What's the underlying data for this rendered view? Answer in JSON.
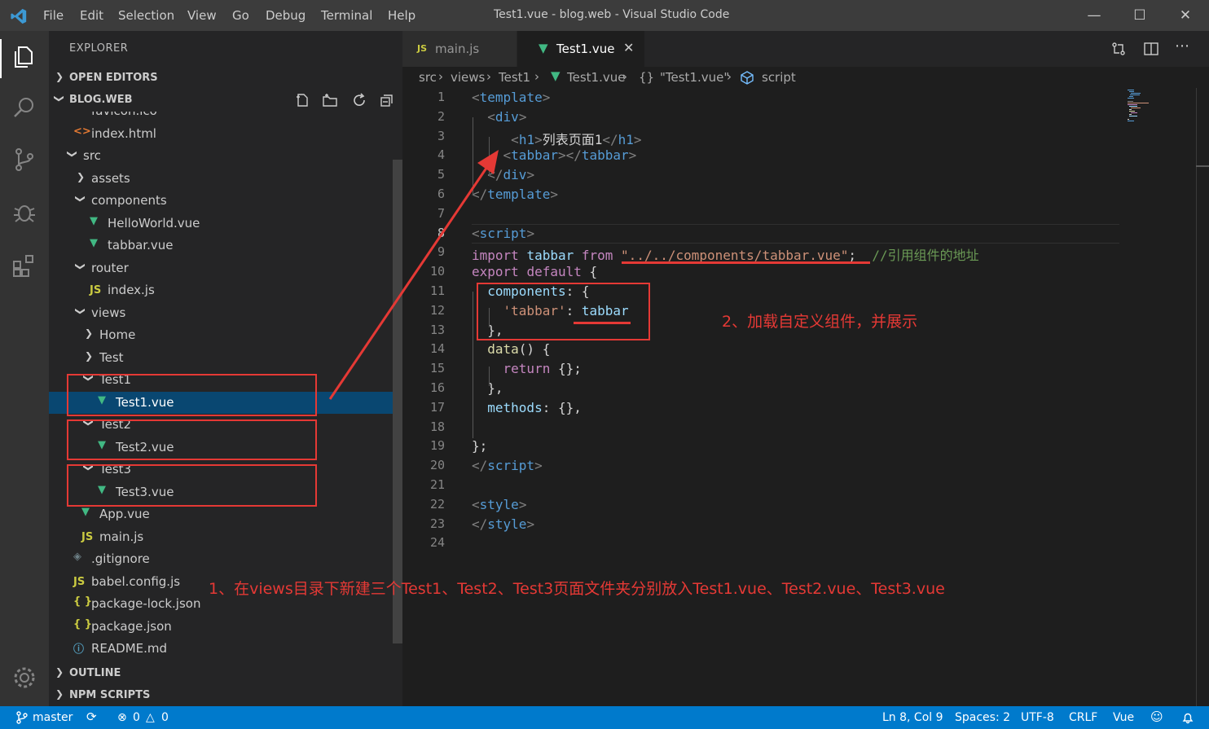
{
  "titlebar": {
    "menu": [
      "File",
      "Edit",
      "Selection",
      "View",
      "Go",
      "Debug",
      "Terminal",
      "Help"
    ],
    "title": "Test1.vue - blog.web - Visual Studio Code",
    "vscode_color": "#3c99d4"
  },
  "activity": [
    "files-icon",
    "search-icon",
    "source-control-icon",
    "debug-icon",
    "extensions-icon",
    "settings-gear-icon"
  ],
  "sidebar": {
    "header": "EXPLORER",
    "open_editors": "OPEN EDITORS",
    "folder": "BLOG.WEB",
    "outline": "OUTLINE",
    "npm": "NPM SCRIPTS",
    "tree": [
      {
        "label": "favicon.ico",
        "icon": "star"
      },
      {
        "label": "index.html",
        "icon": "html"
      },
      {
        "label": "src",
        "icon": "folder-open"
      },
      {
        "label": "assets",
        "icon": "folder-closed"
      },
      {
        "label": "components",
        "icon": "folder-open"
      },
      {
        "label": "HelloWorld.vue",
        "icon": "vue"
      },
      {
        "label": "tabbar.vue",
        "icon": "vue"
      },
      {
        "label": "router",
        "icon": "folder-open"
      },
      {
        "label": "index.js",
        "icon": "js"
      },
      {
        "label": "views",
        "icon": "folder-open"
      },
      {
        "label": "Home",
        "icon": "folder-closed"
      },
      {
        "label": "Test",
        "icon": "folder-closed"
      },
      {
        "label": "Test1",
        "icon": "folder-open"
      },
      {
        "label": "Test1.vue",
        "icon": "vue"
      },
      {
        "label": "Test2",
        "icon": "folder-open"
      },
      {
        "label": "Test2.vue",
        "icon": "vue"
      },
      {
        "label": "Test3",
        "icon": "folder-open"
      },
      {
        "label": "Test3.vue",
        "icon": "vue"
      },
      {
        "label": "App.vue",
        "icon": "vue"
      },
      {
        "label": "main.js",
        "icon": "js"
      },
      {
        "label": ".gitignore",
        "icon": "git"
      },
      {
        "label": "babel.config.js",
        "icon": "js"
      },
      {
        "label": "package-lock.json",
        "icon": "json"
      },
      {
        "label": "package.json",
        "icon": "json"
      },
      {
        "label": "README.md",
        "icon": "info"
      }
    ]
  },
  "tabs": [
    {
      "label": "main.js",
      "badge": "JS",
      "active": false
    },
    {
      "label": "Test1.vue",
      "active": true
    }
  ],
  "breadcrumb": [
    "src",
    "views",
    "Test1",
    "Test1.vue",
    "{}",
    "\"Test1.vue\"",
    "script"
  ],
  "editor": {
    "line_numbers": [
      "1",
      "2",
      "3",
      "4",
      "5",
      "6",
      "7",
      "8",
      "9",
      "10",
      "11",
      "12",
      "13",
      "14",
      "15",
      "16",
      "17",
      "18",
      "19",
      "20",
      "21",
      "22",
      "23",
      "24"
    ],
    "lines": [
      [
        [
          "k-br",
          "<"
        ],
        [
          "k-tag",
          "template"
        ],
        [
          "k-br",
          ">"
        ]
      ],
      [
        [
          "k-punc",
          "  "
        ],
        [
          "k-br",
          "<"
        ],
        [
          "k-tag",
          "div"
        ],
        [
          "k-br",
          ">"
        ]
      ],
      [
        [
          "k-punc",
          "     "
        ],
        [
          "k-br",
          "<"
        ],
        [
          "k-tag",
          "h1"
        ],
        [
          "k-br",
          ">"
        ],
        [
          "k-punc",
          "列表页面1"
        ],
        [
          "k-br",
          "</"
        ],
        [
          "k-tag",
          "h1"
        ],
        [
          "k-br",
          ">"
        ]
      ],
      [
        [
          "k-punc",
          "    "
        ],
        [
          "k-br",
          "<"
        ],
        [
          "k-tag",
          "tabbar"
        ],
        [
          "k-br",
          "></"
        ],
        [
          "k-tag",
          "tabbar"
        ],
        [
          "k-br",
          ">"
        ]
      ],
      [
        [
          "k-punc",
          "  "
        ],
        [
          "k-br",
          "</"
        ],
        [
          "k-tag",
          "div"
        ],
        [
          "k-br",
          ">"
        ]
      ],
      [
        [
          "k-br",
          "</"
        ],
        [
          "k-tag",
          "template"
        ],
        [
          "k-br",
          ">"
        ]
      ],
      [],
      [
        [
          "k-br",
          "<"
        ],
        [
          "k-tag",
          "script"
        ],
        [
          "k-br",
          ">"
        ]
      ],
      [
        [
          "k-kw",
          "import"
        ],
        [
          "k-punc",
          " "
        ],
        [
          "k-var",
          "tabbar"
        ],
        [
          "k-punc",
          " "
        ],
        [
          "k-kw",
          "from"
        ],
        [
          "k-punc",
          " "
        ],
        [
          "k-str",
          "\"../../components/tabbar.vue\""
        ],
        [
          "k-punc",
          ";  "
        ],
        [
          "k-cm",
          "//引用组件的地址"
        ]
      ],
      [
        [
          "k-kw",
          "export"
        ],
        [
          "k-punc",
          " "
        ],
        [
          "k-kw",
          "default"
        ],
        [
          "k-punc",
          " {"
        ]
      ],
      [
        [
          "k-punc",
          "  "
        ],
        [
          "k-var",
          "components"
        ],
        [
          "k-punc",
          ": {"
        ]
      ],
      [
        [
          "k-punc",
          "    "
        ],
        [
          "k-str",
          "'tabbar'"
        ],
        [
          "k-punc",
          ": "
        ],
        [
          "k-var",
          "tabbar"
        ]
      ],
      [
        [
          "k-punc",
          "  },"
        ]
      ],
      [
        [
          "k-punc",
          "  "
        ],
        [
          "k-fn",
          "data"
        ],
        [
          "k-punc",
          "() {"
        ]
      ],
      [
        [
          "k-punc",
          "    "
        ],
        [
          "k-kw",
          "return"
        ],
        [
          "k-punc",
          " {};"
        ]
      ],
      [
        [
          "k-punc",
          "  },"
        ]
      ],
      [
        [
          "k-punc",
          "  "
        ],
        [
          "k-var",
          "methods"
        ],
        [
          "k-punc",
          ": {},"
        ]
      ],
      [],
      [
        [
          "k-punc",
          "};"
        ]
      ],
      [
        [
          "k-br",
          "</"
        ],
        [
          "k-tag",
          "script"
        ],
        [
          "k-br",
          ">"
        ]
      ],
      [],
      [
        [
          "k-br",
          "<"
        ],
        [
          "k-tag",
          "style"
        ],
        [
          "k-br",
          ">"
        ]
      ],
      [
        [
          "k-br",
          "</"
        ],
        [
          "k-tag",
          "style"
        ],
        [
          "k-br",
          ">"
        ]
      ],
      []
    ]
  },
  "annotations": {
    "step1": "1、在views目录下新建三个Test1、Test2、Test3页面文件夹分别放入Test1.vue、Test2.vue、Test3.vue",
    "step2": "2、加载自定义组件，并展示",
    "color": "#e53935"
  },
  "statusbar": {
    "branch": "master",
    "errors": "0",
    "warnings": "0",
    "position": "Ln 8, Col 9",
    "spaces": "Spaces: 2",
    "encoding": "UTF-8",
    "eol": "CRLF",
    "language": "Vue"
  }
}
